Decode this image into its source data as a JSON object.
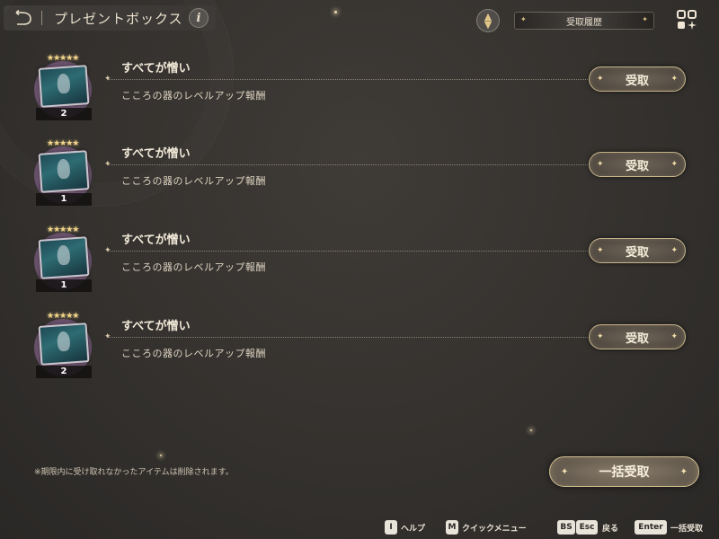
{
  "header": {
    "title": "プレゼントボックス",
    "info_label": "i",
    "history_label": "受取履歴"
  },
  "items": [
    {
      "name": "すべてが憎い",
      "source": "こころの器のレベルアップ報酬",
      "quantity": "2",
      "rarity": 5,
      "claim_label": "受取"
    },
    {
      "name": "すべてが憎い",
      "source": "こころの器のレベルアップ報酬",
      "quantity": "1",
      "rarity": 5,
      "claim_label": "受取"
    },
    {
      "name": "すべてが憎い",
      "source": "こころの器のレベルアップ報酬",
      "quantity": "1",
      "rarity": 5,
      "claim_label": "受取"
    },
    {
      "name": "すべてが憎い",
      "source": "こころの器のレベルアップ報酬",
      "quantity": "2",
      "rarity": 5,
      "claim_label": "受取"
    }
  ],
  "notice": "※期限内に受け取れなかったアイテムは削除されます。",
  "claim_all_label": "一括受取",
  "footer": {
    "help_key": "I",
    "help_label": "ヘルプ",
    "menu_key": "M",
    "menu_label": "クイックメニュー",
    "back_key_1": "BS",
    "back_key_2": "Esc",
    "back_label": "戻る",
    "enter_key": "Enter",
    "enter_label": "一括受取"
  },
  "colors": {
    "accent_gold": "#c7b48a",
    "background": "#34312e",
    "text": "#efe6d6"
  }
}
